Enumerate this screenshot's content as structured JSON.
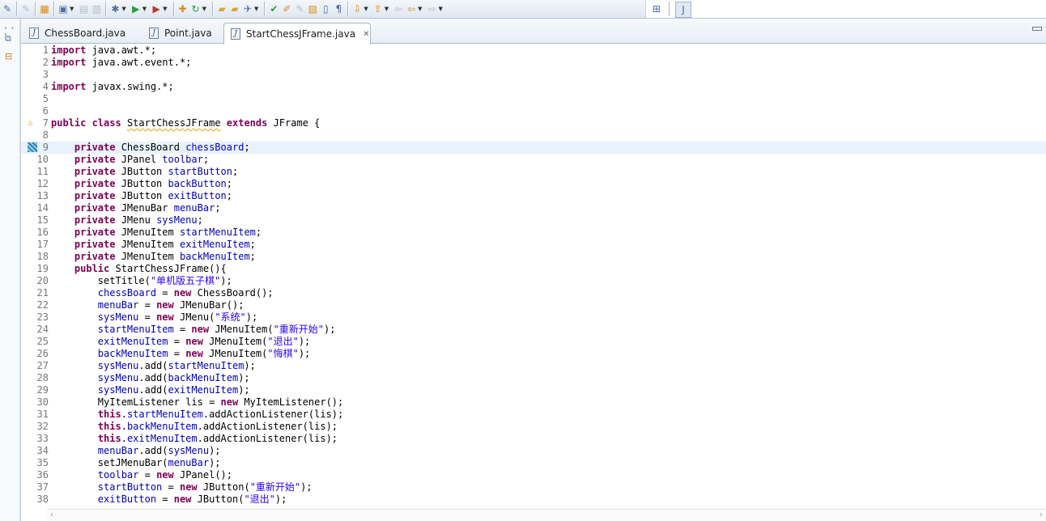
{
  "toolbar": {
    "icons": [
      "pin-icon",
      "new-icon",
      "package-icon",
      "new-wizard-icon",
      "save-icon",
      "save-all-icon",
      "debug-icon",
      "run-icon",
      "external-tools-icon",
      "new-java-class-icon",
      "refresh-icon",
      "open-type-icon",
      "open-folder-icon",
      "search-icon",
      "annotation-icon",
      "pencil-icon",
      "edit-icon",
      "task-icon",
      "block-icon",
      "paragraph-icon",
      "next-annotation-icon",
      "prev-annotation-icon",
      "last-edit-icon",
      "back-icon",
      "forward-icon",
      "open-perspective-icon",
      "java-perspective-icon"
    ]
  },
  "tabs": [
    {
      "label": "ChessBoard.java",
      "active": false
    },
    {
      "label": "Point.java",
      "active": false
    },
    {
      "label": "StartChessJFrame.java",
      "active": true
    }
  ],
  "editor": {
    "highlight_line": 9,
    "lines": [
      {
        "n": "1",
        "tokens": [
          [
            "kw",
            "import"
          ],
          [
            "t",
            " java.awt.*;"
          ]
        ]
      },
      {
        "n": "2",
        "tokens": [
          [
            "kw",
            "import"
          ],
          [
            "t",
            " java.awt.event.*;"
          ]
        ]
      },
      {
        "n": "3",
        "tokens": []
      },
      {
        "n": "4",
        "tokens": [
          [
            "kw",
            "import"
          ],
          [
            "t",
            " javax.swing.*;"
          ]
        ]
      },
      {
        "n": "5",
        "tokens": []
      },
      {
        "n": "6",
        "tokens": []
      },
      {
        "n": "7",
        "marker": "warn",
        "tokens": [
          [
            "kw",
            "public"
          ],
          [
            "t",
            " "
          ],
          [
            "kw",
            "class"
          ],
          [
            "t",
            " "
          ],
          [
            "cls",
            "StartChessJFrame"
          ],
          [
            "t",
            " "
          ],
          [
            "kw",
            "extends"
          ],
          [
            "t",
            " JFrame {"
          ]
        ]
      },
      {
        "n": "8",
        "tokens": []
      },
      {
        "n": "9",
        "marker": "bm",
        "tokens": [
          [
            "t",
            "    "
          ],
          [
            "kw",
            "private"
          ],
          [
            "t",
            " ChessBoard "
          ],
          [
            "fld",
            "chessBoard"
          ],
          [
            "t",
            ";"
          ]
        ]
      },
      {
        "n": "10",
        "tokens": [
          [
            "t",
            "    "
          ],
          [
            "kw",
            "private"
          ],
          [
            "t",
            " JPanel "
          ],
          [
            "fld",
            "toolbar"
          ],
          [
            "t",
            ";"
          ]
        ]
      },
      {
        "n": "11",
        "tokens": [
          [
            "t",
            "    "
          ],
          [
            "kw",
            "private"
          ],
          [
            "t",
            " JButton "
          ],
          [
            "fld",
            "startButton"
          ],
          [
            "t",
            ";"
          ]
        ]
      },
      {
        "n": "12",
        "tokens": [
          [
            "t",
            "    "
          ],
          [
            "kw",
            "private"
          ],
          [
            "t",
            " JButton "
          ],
          [
            "fld",
            "backButton"
          ],
          [
            "t",
            ";"
          ]
        ]
      },
      {
        "n": "13",
        "tokens": [
          [
            "t",
            "    "
          ],
          [
            "kw",
            "private"
          ],
          [
            "t",
            " JButton "
          ],
          [
            "fld",
            "exitButton"
          ],
          [
            "t",
            ";"
          ]
        ]
      },
      {
        "n": "14",
        "tokens": [
          [
            "t",
            "    "
          ],
          [
            "kw",
            "private"
          ],
          [
            "t",
            " JMenuBar "
          ],
          [
            "fld",
            "menuBar"
          ],
          [
            "t",
            ";"
          ]
        ]
      },
      {
        "n": "15",
        "tokens": [
          [
            "t",
            "    "
          ],
          [
            "kw",
            "private"
          ],
          [
            "t",
            " JMenu "
          ],
          [
            "fld",
            "sysMenu"
          ],
          [
            "t",
            ";"
          ]
        ]
      },
      {
        "n": "16",
        "tokens": [
          [
            "t",
            "    "
          ],
          [
            "kw",
            "private"
          ],
          [
            "t",
            " JMenuItem "
          ],
          [
            "fld",
            "startMenuItem"
          ],
          [
            "t",
            ";"
          ]
        ]
      },
      {
        "n": "17",
        "tokens": [
          [
            "t",
            "    "
          ],
          [
            "kw",
            "private"
          ],
          [
            "t",
            " JMenuItem "
          ],
          [
            "fld",
            "exitMenuItem"
          ],
          [
            "t",
            ";"
          ]
        ]
      },
      {
        "n": "18",
        "tokens": [
          [
            "t",
            "    "
          ],
          [
            "kw",
            "private"
          ],
          [
            "t",
            " JMenuItem "
          ],
          [
            "fld",
            "backMenuItem"
          ],
          [
            "t",
            ";"
          ]
        ]
      },
      {
        "n": "19",
        "tokens": [
          [
            "t",
            "    "
          ],
          [
            "kw",
            "public"
          ],
          [
            "t",
            " StartChessJFrame(){"
          ]
        ]
      },
      {
        "n": "20",
        "tokens": [
          [
            "t",
            "        setTitle("
          ],
          [
            "str",
            "\"单机版五子棋\""
          ],
          [
            "t",
            ");"
          ]
        ]
      },
      {
        "n": "21",
        "tokens": [
          [
            "t",
            "        "
          ],
          [
            "fld",
            "chessBoard"
          ],
          [
            "t",
            " = "
          ],
          [
            "kw",
            "new"
          ],
          [
            "t",
            " ChessBoard();"
          ]
        ]
      },
      {
        "n": "22",
        "tokens": [
          [
            "t",
            "        "
          ],
          [
            "fld",
            "menuBar"
          ],
          [
            "t",
            " = "
          ],
          [
            "kw",
            "new"
          ],
          [
            "t",
            " JMenuBar();"
          ]
        ]
      },
      {
        "n": "23",
        "tokens": [
          [
            "t",
            "        "
          ],
          [
            "fld",
            "sysMenu"
          ],
          [
            "t",
            " = "
          ],
          [
            "kw",
            "new"
          ],
          [
            "t",
            " JMenu("
          ],
          [
            "str",
            "\"系统\""
          ],
          [
            "t",
            ");"
          ]
        ]
      },
      {
        "n": "24",
        "tokens": [
          [
            "t",
            "        "
          ],
          [
            "fld",
            "startMenuItem"
          ],
          [
            "t",
            " = "
          ],
          [
            "kw",
            "new"
          ],
          [
            "t",
            " JMenuItem("
          ],
          [
            "str",
            "\"重新开始\""
          ],
          [
            "t",
            ");"
          ]
        ]
      },
      {
        "n": "25",
        "tokens": [
          [
            "t",
            "        "
          ],
          [
            "fld",
            "exitMenuItem"
          ],
          [
            "t",
            " = "
          ],
          [
            "kw",
            "new"
          ],
          [
            "t",
            " JMenuItem("
          ],
          [
            "str",
            "\"退出\""
          ],
          [
            "t",
            ");"
          ]
        ]
      },
      {
        "n": "26",
        "tokens": [
          [
            "t",
            "        "
          ],
          [
            "fld",
            "backMenuItem"
          ],
          [
            "t",
            " = "
          ],
          [
            "kw",
            "new"
          ],
          [
            "t",
            " JMenuItem("
          ],
          [
            "str",
            "\"悔棋\""
          ],
          [
            "t",
            ");"
          ]
        ]
      },
      {
        "n": "27",
        "tokens": [
          [
            "t",
            "        "
          ],
          [
            "fld",
            "sysMenu"
          ],
          [
            "t",
            ".add("
          ],
          [
            "fld",
            "startMenuItem"
          ],
          [
            "t",
            ");"
          ]
        ]
      },
      {
        "n": "28",
        "tokens": [
          [
            "t",
            "        "
          ],
          [
            "fld",
            "sysMenu"
          ],
          [
            "t",
            ".add("
          ],
          [
            "fld",
            "backMenuItem"
          ],
          [
            "t",
            ");"
          ]
        ]
      },
      {
        "n": "29",
        "tokens": [
          [
            "t",
            "        "
          ],
          [
            "fld",
            "sysMenu"
          ],
          [
            "t",
            ".add("
          ],
          [
            "fld",
            "exitMenuItem"
          ],
          [
            "t",
            ");"
          ]
        ]
      },
      {
        "n": "30",
        "tokens": [
          [
            "t",
            "        MyItemListener lis = "
          ],
          [
            "kw",
            "new"
          ],
          [
            "t",
            " MyItemListener();"
          ]
        ]
      },
      {
        "n": "31",
        "tokens": [
          [
            "t",
            "        "
          ],
          [
            "kw",
            "this"
          ],
          [
            "t",
            "."
          ],
          [
            "fld",
            "startMenuItem"
          ],
          [
            "t",
            ".addActionListener(lis);"
          ]
        ]
      },
      {
        "n": "32",
        "tokens": [
          [
            "t",
            "        "
          ],
          [
            "kw",
            "this"
          ],
          [
            "t",
            "."
          ],
          [
            "fld",
            "backMenuItem"
          ],
          [
            "t",
            ".addActionListener(lis);"
          ]
        ]
      },
      {
        "n": "33",
        "tokens": [
          [
            "t",
            "        "
          ],
          [
            "kw",
            "this"
          ],
          [
            "t",
            "."
          ],
          [
            "fld",
            "exitMenuItem"
          ],
          [
            "t",
            ".addActionListener(lis);"
          ]
        ]
      },
      {
        "n": "34",
        "tokens": [
          [
            "t",
            "        "
          ],
          [
            "fld",
            "menuBar"
          ],
          [
            "t",
            ".add("
          ],
          [
            "fld",
            "sysMenu"
          ],
          [
            "t",
            ");"
          ]
        ]
      },
      {
        "n": "35",
        "tokens": [
          [
            "t",
            "        setJMenuBar("
          ],
          [
            "fld",
            "menuBar"
          ],
          [
            "t",
            ");"
          ]
        ]
      },
      {
        "n": "36",
        "tokens": [
          [
            "t",
            "        "
          ],
          [
            "fld",
            "toolbar"
          ],
          [
            "t",
            " = "
          ],
          [
            "kw",
            "new"
          ],
          [
            "t",
            " JPanel();"
          ]
        ]
      },
      {
        "n": "37",
        "tokens": [
          [
            "t",
            "        "
          ],
          [
            "fld",
            "startButton"
          ],
          [
            "t",
            " = "
          ],
          [
            "kw",
            "new"
          ],
          [
            "t",
            " JButton("
          ],
          [
            "str",
            "\"重新开始\""
          ],
          [
            "t",
            ");"
          ]
        ]
      },
      {
        "n": "38",
        "tokens": [
          [
            "t",
            "        "
          ],
          [
            "fld",
            "exitButton"
          ],
          [
            "t",
            " = "
          ],
          [
            "kw",
            "new"
          ],
          [
            "t",
            " JButton("
          ],
          [
            "str",
            "\"退出\""
          ],
          [
            "t",
            ");"
          ]
        ]
      }
    ]
  },
  "colors": {
    "keyword": "#7f0055",
    "field": "#0000c0",
    "string": "#2a00ff",
    "line_number": "#787878",
    "current_line": "#e8f2fe"
  }
}
